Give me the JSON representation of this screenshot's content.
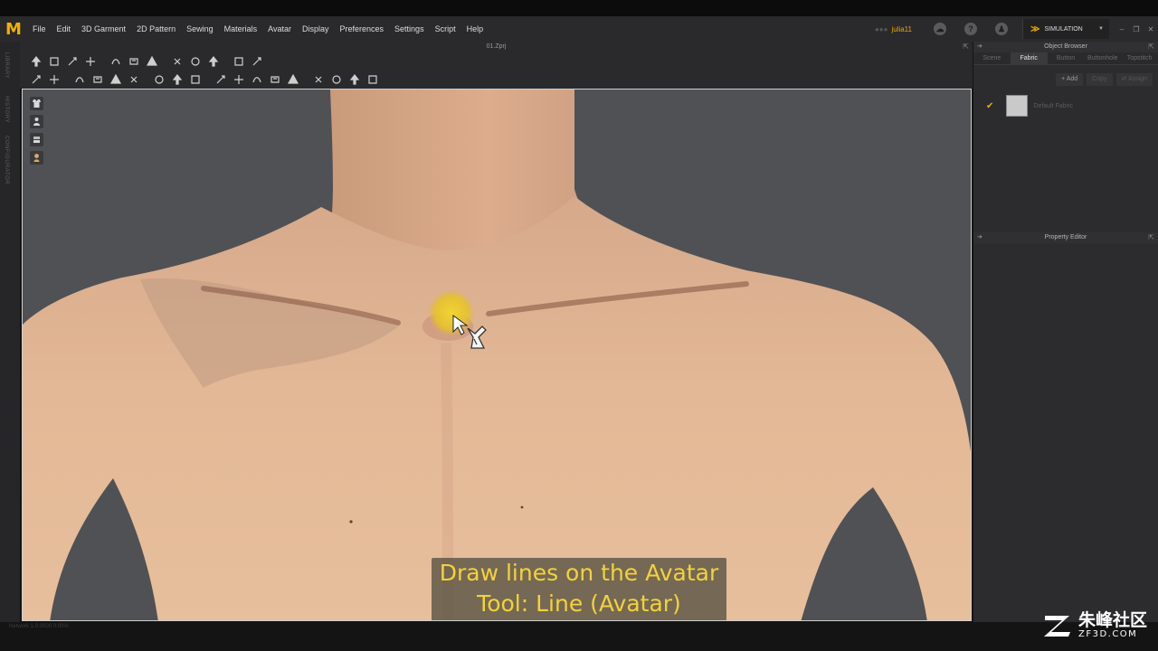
{
  "app": {
    "logo": "M",
    "menu": [
      "File",
      "Edit",
      "3D Garment",
      "2D Pattern",
      "Sewing",
      "Materials",
      "Avatar",
      "Display",
      "Preferences",
      "Settings",
      "Script",
      "Help"
    ],
    "user": "julia11",
    "mode": "SIMULATION",
    "file_title": "01.Zprj",
    "accent_color": "#f2b100"
  },
  "left_strip": {
    "tabs": [
      "LIBRARY",
      "HISTORY",
      "CONFIGURATOR"
    ]
  },
  "toolbar": {
    "row1_icons": [
      "select-move-icon",
      "transform-pattern-icon",
      "rectangle-icon",
      "edit-point-icon",
      "edit-curve-icon",
      "polygon-icon",
      "internal-polygon-icon",
      "dart-icon",
      "trace-icon",
      "fold-arrangement-icon",
      "lasso-icon",
      "pencil-icon"
    ],
    "row2_icons": [
      "select-mesh-icon",
      "transform-icon",
      "tack-icon",
      "pin-icon",
      "steam-icon",
      "fold-icon",
      "zipper-icon",
      "button-icon",
      "buttonhole-icon",
      "point-icon",
      "line-icon",
      "measure-icon",
      "tape-icon",
      "segment-icon",
      "avatar-line-icon",
      "avatar-point-icon",
      "arrangement-icon",
      "fitting-suit-icon"
    ]
  },
  "viewport": {
    "side_tools": [
      "garment-icon",
      "avatar-icon",
      "layer-icon",
      "skin-icon"
    ],
    "caption_line1": "Draw lines on the Avatar",
    "caption_line2": "Tool: Line (Avatar)",
    "caption_color": "#f3d23a"
  },
  "object_browser": {
    "title": "Object Browser",
    "tabs": [
      "Scene",
      "Fabric",
      "Button",
      "Buttonhole",
      "Topstitch"
    ],
    "active_tab": "Fabric",
    "actions": {
      "add": "Add",
      "copy": "Copy",
      "assign": "Assign"
    },
    "fabric_item": "Default Fabric"
  },
  "property_editor": {
    "title": "Property Editor"
  },
  "status": {
    "text": "Network 1.0.0000   0.00%"
  },
  "watermark": {
    "cn": "朱峰社区",
    "en": "ZF3D.COM"
  }
}
